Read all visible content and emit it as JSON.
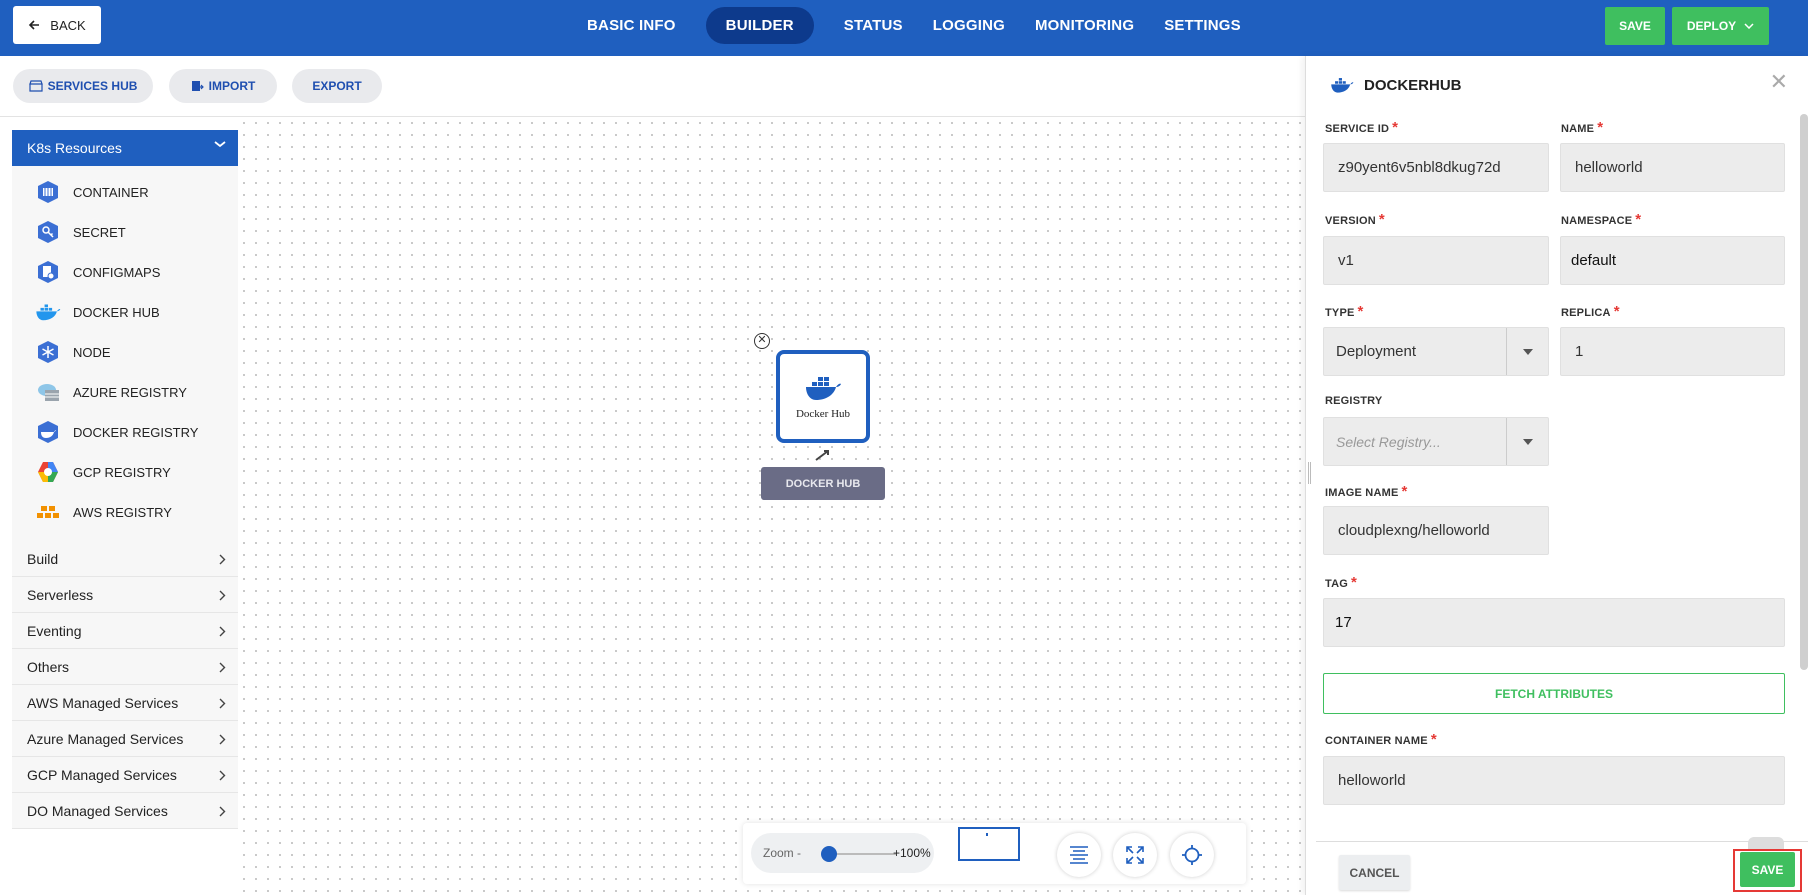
{
  "header": {
    "back_label": "BACK",
    "nav": [
      "BASIC INFO",
      "BUILDER",
      "STATUS",
      "LOGGING",
      "MONITORING",
      "SETTINGS"
    ],
    "active_nav": "BUILDER",
    "save_label": "SAVE",
    "deploy_label": "DEPLOY"
  },
  "toolbar": {
    "services_hub": "SERVICES HUB",
    "import": "IMPORT",
    "export": "EXPORT"
  },
  "sidebar": {
    "section_title": "K8s Resources",
    "items": [
      {
        "label": "CONTAINER",
        "icon": "container-icon"
      },
      {
        "label": "SECRET",
        "icon": "secret-icon"
      },
      {
        "label": "CONFIGMAPS",
        "icon": "configmap-icon"
      },
      {
        "label": "DOCKER HUB",
        "icon": "docker-icon"
      },
      {
        "label": "NODE",
        "icon": "node-icon"
      },
      {
        "label": "AZURE REGISTRY",
        "icon": "azure-icon"
      },
      {
        "label": "DOCKER REGISTRY",
        "icon": "docker-registry-icon"
      },
      {
        "label": "GCP REGISTRY",
        "icon": "gcp-icon"
      },
      {
        "label": "AWS REGISTRY",
        "icon": "aws-icon"
      }
    ],
    "categories": [
      "Build",
      "Serverless",
      "Eventing",
      "Others",
      "AWS Managed Services",
      "Azure Managed Services",
      "GCP Managed Services",
      "DO Managed Services"
    ]
  },
  "canvas": {
    "node_label": "Docker Hub",
    "node_tag": "DOCKER HUB",
    "zoom_label": "Zoom -",
    "zoom_value": "+100%",
    "zoom_level": 1.0
  },
  "panel": {
    "title": "DOCKERHUB",
    "fields": {
      "service_id": {
        "label": "SERVICE ID",
        "value": "z90yent6v5nbl8dkug72d"
      },
      "name": {
        "label": "NAME",
        "value": "helloworld"
      },
      "version": {
        "label": "VERSION",
        "value": "v1"
      },
      "namespace": {
        "label": "NAMESPACE",
        "value": "default"
      },
      "type": {
        "label": "TYPE",
        "value": "Deployment"
      },
      "replica": {
        "label": "REPLICA",
        "value": "1"
      },
      "registry": {
        "label": "REGISTRY",
        "placeholder": "Select Registry..."
      },
      "image_name": {
        "label": "IMAGE NAME",
        "value": "cloudplexng/helloworld"
      },
      "tag": {
        "label": "TAG",
        "value": "17"
      },
      "container_name": {
        "label": "CONTAINER NAME",
        "value": "helloworld"
      }
    },
    "fetch_label": "FETCH ATTRIBUTES",
    "cancel_label": "CANCEL",
    "save_label": "SAVE"
  },
  "colors": {
    "primary": "#1f5fbf",
    "success": "#3fbf5f",
    "danger": "#e53935"
  }
}
